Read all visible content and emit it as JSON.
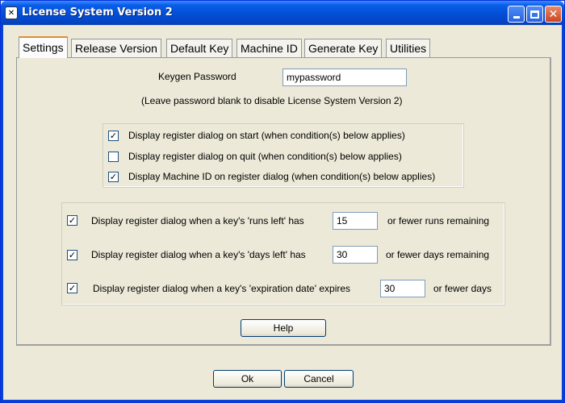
{
  "window": {
    "title": "License System Version 2",
    "app_icon": "license-app-icon",
    "accent": "#0450d8"
  },
  "tabs": [
    {
      "label": "Settings",
      "active": true
    },
    {
      "label": "Release Version"
    },
    {
      "label": "Default Key"
    },
    {
      "label": "Machine ID"
    },
    {
      "label": "Generate Key"
    },
    {
      "label": "Utilities"
    }
  ],
  "settings": {
    "keygen_password_label": "Keygen Password",
    "keygen_password_value": "mypassword",
    "hint": "(Leave password blank to disable License System Version 2)",
    "display_options": [
      {
        "label": "Display register dialog on start (when condition(s) below applies)",
        "checked": true
      },
      {
        "label": "Display register dialog on quit (when condition(s) below applies)",
        "checked": false
      },
      {
        "label": "Display Machine ID on register dialog (when condition(s) below applies)",
        "checked": true
      }
    ],
    "conditions": [
      {
        "label": "Display register dialog when a key's 'runs left' has",
        "value": "15",
        "suffix": "or fewer runs remaining",
        "checked": true
      },
      {
        "label": "Display register dialog when a key's 'days left' has",
        "value": "30",
        "suffix": "or fewer days remaining",
        "checked": true
      },
      {
        "label": "Display register dialog when a key's 'expiration date' expires",
        "value": "30",
        "suffix": "or fewer days",
        "checked": true
      }
    ],
    "help_label": "Help"
  },
  "footer": {
    "ok_label": "Ok",
    "cancel_label": "Cancel"
  }
}
